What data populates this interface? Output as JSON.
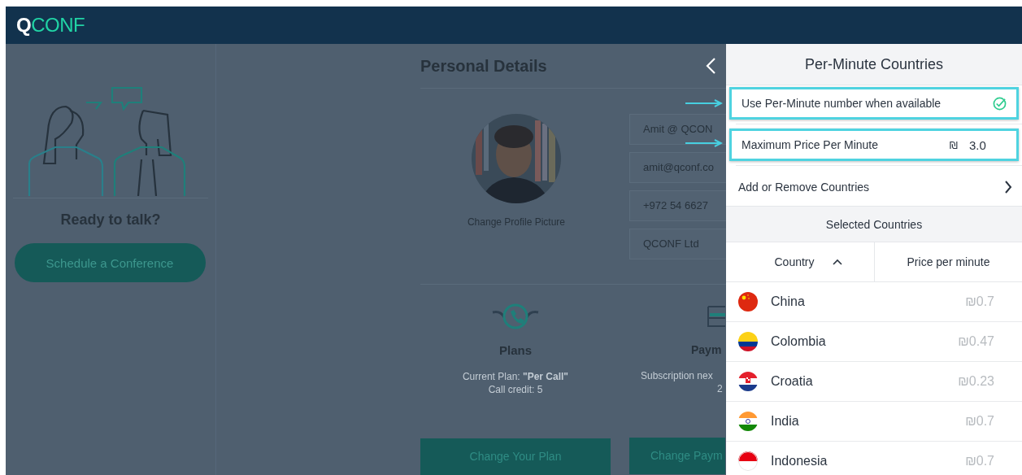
{
  "header": {
    "logo_mark": "Q",
    "logo_text": "CONF"
  },
  "background_page": {
    "sidebar": {
      "prompt": "Ready to talk?",
      "button": "Schedule a Conference"
    },
    "title": "Personal Details",
    "profile": {
      "link": "Change Profile Picture"
    },
    "fields": [
      {
        "value": "Amit @ QCON"
      },
      {
        "value": "amit@qconf.co"
      },
      {
        "value": "+972 54 6627"
      },
      {
        "value": "QCONF Ltd"
      }
    ],
    "cards": [
      {
        "kind": "plans",
        "title": "Plans",
        "lines": [
          "Current Plan: **\"Per Call\"**",
          "Call credit: 5"
        ],
        "button": "Change Your Plan"
      },
      {
        "kind": "payment",
        "title": "Paym",
        "lines": [
          "Subscription nex",
          "2"
        ],
        "button": "Change Paym"
      }
    ]
  },
  "panel": {
    "title": "Per-Minute Countries",
    "use_per_minute": {
      "label": "Use Per-Minute number when available",
      "checked": true,
      "highlighted": true
    },
    "max_price": {
      "label": "Maximum Price Per Minute",
      "currency": "₪",
      "value": "3.0",
      "highlighted": true
    },
    "add_remove": "Add or Remove Countries",
    "section": "Selected Countries",
    "columns": [
      {
        "label": "Country",
        "sorted": true
      },
      {
        "label": "Price per minute",
        "sorted": false
      }
    ],
    "rows": [
      {
        "country": "China",
        "kind": "cn",
        "price": "₪0.7"
      },
      {
        "country": "Colombia",
        "kind": "co",
        "price": "₪0.47"
      },
      {
        "country": "Croatia",
        "kind": "hr",
        "price": "₪0.23"
      },
      {
        "country": "India",
        "kind": "in",
        "price": "₪0.7"
      },
      {
        "country": "Indonesia",
        "kind": "id",
        "price": "₪0.7"
      }
    ]
  }
}
